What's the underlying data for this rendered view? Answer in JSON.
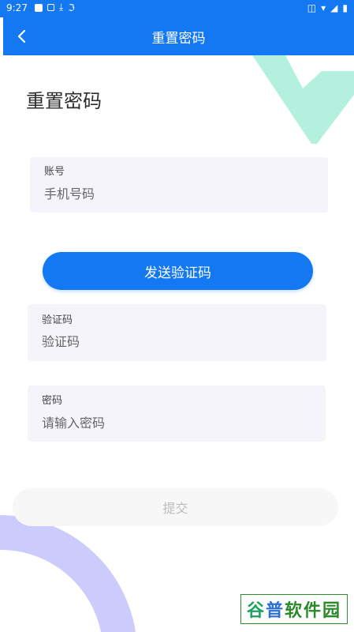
{
  "status_bar": {
    "time": "9:27"
  },
  "app_bar": {
    "title": "重置密码"
  },
  "page": {
    "heading": "重置密码"
  },
  "account_field": {
    "label": "账号",
    "placeholder": "手机号码",
    "value": ""
  },
  "send_code_button": {
    "label": "发送验证码"
  },
  "code_field": {
    "label": "验证码",
    "placeholder": "验证码",
    "value": ""
  },
  "password_field": {
    "label": "密码",
    "placeholder": "请输入密码",
    "value": ""
  },
  "submit_button": {
    "label": "提交"
  },
  "watermark": {
    "part1": "谷",
    "part2": "普",
    "part3": "软件园"
  },
  "colors": {
    "primary": "#1378f2",
    "field_bg": "#f6f4fb",
    "deco_green": "#b3f0dd",
    "deco_purple": "#cdcbfb"
  }
}
